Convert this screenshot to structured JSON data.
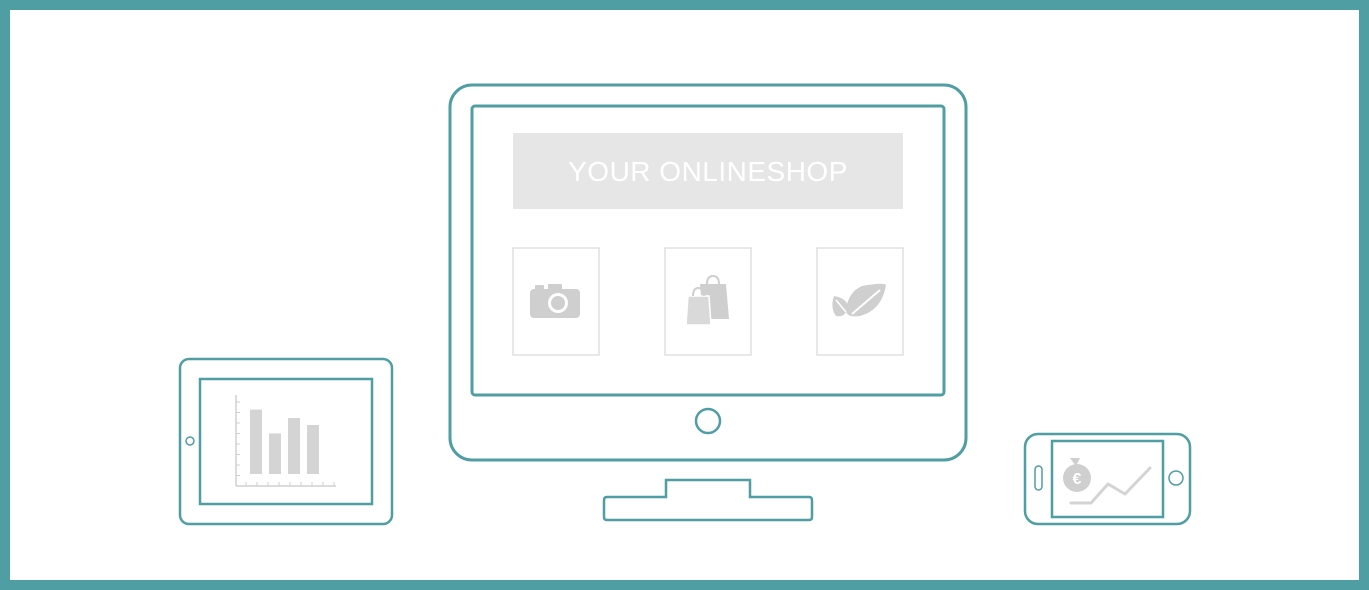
{
  "colors": {
    "frame": "#4f9ea3",
    "outline": "#4f9ea3",
    "gray_fill": "#e6e6e6",
    "gray_icon": "#cfcfcf",
    "gray_text": "#ffffff",
    "tile_border": "#e0e0e0"
  },
  "monitor": {
    "header_text": "YOUR ONLINESHOP",
    "tiles": [
      {
        "icon": "camera-icon"
      },
      {
        "icon": "shopping-bags-icon"
      },
      {
        "icon": "leaves-icon"
      }
    ]
  },
  "tablet": {
    "content": "bar-chart-icon",
    "bars": [
      0.92,
      0.58,
      0.8,
      0.7
    ]
  },
  "phone": {
    "content": "euro-money-bag-trend-icon"
  }
}
